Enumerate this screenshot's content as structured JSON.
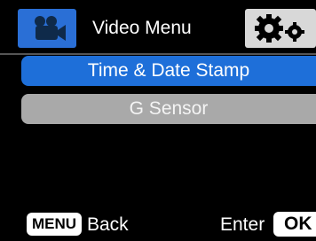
{
  "header": {
    "video_icon": "video-camera-icon",
    "title": "Video Menu",
    "settings_icon": "gears-icon"
  },
  "menu": {
    "items": [
      {
        "label": "Time & Date Stamp",
        "selected": true
      },
      {
        "label": "G Sensor",
        "selected": false
      }
    ]
  },
  "footer": {
    "menu_key": "MENU",
    "back_label": "Back",
    "enter_label": "Enter",
    "ok_key": "OK"
  },
  "colors": {
    "selected": "#1e6fd9",
    "unselected": "#a9a9a9",
    "header_icon_bg": "#2a6fd6",
    "settings_bg": "#d8d8d8"
  }
}
